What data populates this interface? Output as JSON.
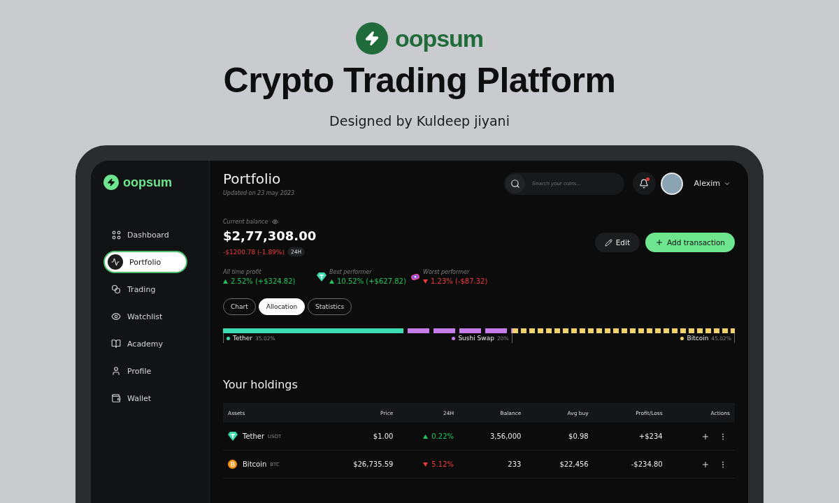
{
  "hero": {
    "brand": "oopsum",
    "title": "Crypto Trading Platform",
    "subtitle": "Designed by Kuldeep jiyani"
  },
  "sidebar": {
    "brand": "oopsum",
    "items": [
      {
        "label": "Dashboard",
        "selected": false
      },
      {
        "label": "Portfolio",
        "selected": true
      },
      {
        "label": "Trading",
        "selected": false
      },
      {
        "label": "Watchlist",
        "selected": false
      },
      {
        "label": "Academy",
        "selected": false
      },
      {
        "label": "Profile",
        "selected": false
      },
      {
        "label": "Wallet",
        "selected": false
      }
    ]
  },
  "header": {
    "title": "Portfolio",
    "updated": "Updated on 23 may 2023",
    "search": {
      "placeholder": "Search your coins..."
    },
    "notifications": {
      "unread": true
    },
    "user": {
      "name": "Alexim"
    }
  },
  "balance": {
    "label": "Current balance",
    "amount": "$2,77,308.00",
    "change": "-$1200.78 (-1.89%)",
    "period": "24H"
  },
  "actions": [
    {
      "label": "Edit",
      "kind": "secondary"
    },
    {
      "label": "Add transaction",
      "kind": "primary"
    }
  ],
  "stats": [
    {
      "label": "All time profit",
      "value": "2.52% (+$324.82)",
      "rising": true,
      "kind": "plain"
    },
    {
      "label": "Best performer",
      "value": "10.52% (+$627.82)",
      "rising": true,
      "kind": "tether"
    },
    {
      "label": "Worst performer",
      "value": "1.23% (-$87.32)",
      "rising": false,
      "kind": "sushi"
    }
  ],
  "tabs": [
    {
      "label": "Chart",
      "selected": false
    },
    {
      "label": "Allocation",
      "selected": true
    },
    {
      "label": "Statistics",
      "selected": false
    }
  ],
  "allocation": [
    {
      "name": "Tether",
      "share": "35.02%",
      "color": "#3ddcb0",
      "kind": "solid"
    },
    {
      "name": "Sushi Swap",
      "share": "20%",
      "color": "#c77dec",
      "kind": "dashed"
    },
    {
      "name": "Bitcoin",
      "share": "45.02%",
      "color": "#f2d36b",
      "kind": "dotted"
    }
  ],
  "holdings": {
    "title": "Your holdings",
    "columns": [
      "Assets",
      "Price",
      "24H",
      "Balance",
      "Avg buy",
      "Profit/Loss",
      "Actions"
    ],
    "rows": [
      {
        "asset": "Tether",
        "ticker": "USDT",
        "kind": "tether",
        "price": "$1.00",
        "change": "0.22%",
        "rising": true,
        "balance": "3,56,000",
        "avg_buy": "$0.98",
        "profit": "+$234"
      },
      {
        "asset": "Bitcoin",
        "ticker": "BTC",
        "kind": "bitcoin",
        "price": "$26,735.59",
        "change": "5.12%",
        "rising": false,
        "balance": "233",
        "avg_buy": "$22,456",
        "profit": "-$234.80"
      }
    ]
  }
}
